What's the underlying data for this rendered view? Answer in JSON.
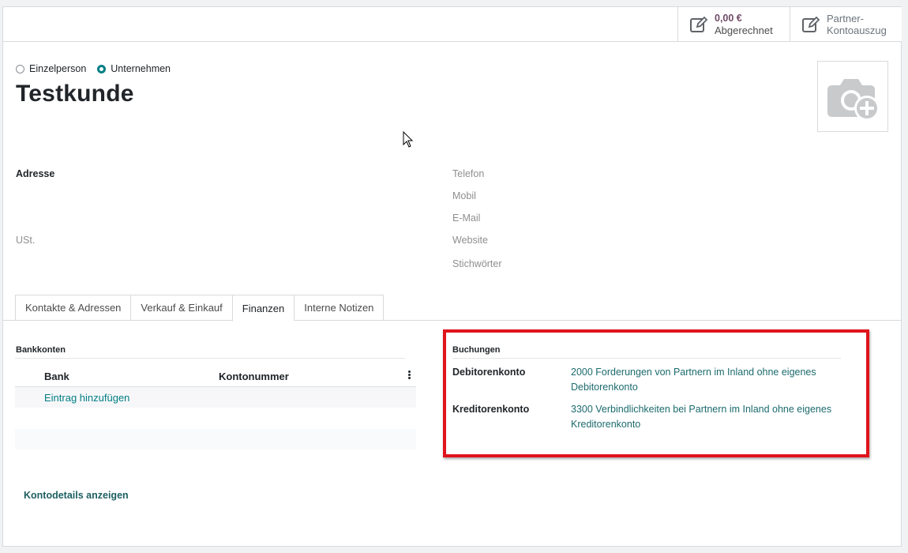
{
  "smart_buttons": [
    {
      "value": "0,00 €",
      "label": "Abgerechnet",
      "icon": "edit-icon"
    },
    {
      "label_line1": "Partner-",
      "label_line2": "Kontoauszug",
      "icon": "edit-icon"
    }
  ],
  "company_type": {
    "options": [
      "Einzelperson",
      "Unternehmen"
    ],
    "selected": "Unternehmen"
  },
  "partner": {
    "name": "Testkunde"
  },
  "avatar": {
    "icon": "camera-add-icon"
  },
  "fields_left": {
    "address": "Adresse",
    "vat": "USt."
  },
  "fields_right": {
    "phone": "Telefon",
    "mobile": "Mobil",
    "email": "E-Mail",
    "website": "Website",
    "tags": "Stichwörter"
  },
  "tabs": [
    {
      "label": "Kontakte & Adressen",
      "active": false
    },
    {
      "label": "Verkauf & Einkauf",
      "active": false
    },
    {
      "label": "Finanzen",
      "active": true
    },
    {
      "label": "Interne Notizen",
      "active": false
    }
  ],
  "bank_accounts": {
    "title": "Bankkonten",
    "columns": [
      "Bank",
      "Kontonummer"
    ],
    "add_label": "Eintrag hinzufügen"
  },
  "account_details_link": "Kontodetails anzeigen",
  "accounting": {
    "title": "Buchungen",
    "receivable_label": "Debitorenkonto",
    "receivable_line1": "2000 Forderungen von Partnern im Inland ohne eigenes",
    "receivable_line2": "Debitorenkonto",
    "payable_label": "Kreditorenkonto",
    "payable_line1": "3300 Verbindlichkeiten bei Partnern im Inland ohne eigenes",
    "payable_line2": "Kreditorenkonto"
  },
  "colors": {
    "accent": "#017e84",
    "highlight": "#e0141c",
    "brand": "#714b67"
  }
}
